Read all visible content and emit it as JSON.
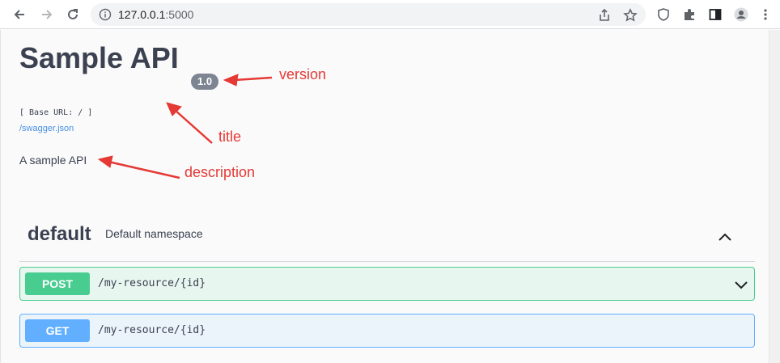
{
  "browser": {
    "url_host": "127.0.0.1",
    "url_port": ":5000"
  },
  "info": {
    "title": "Sample API",
    "version": "1.0",
    "base_url": "[ Base URL: / ]",
    "spec_link": "/swagger.json",
    "description": "A sample API"
  },
  "annotations": {
    "version": "version",
    "title": "title",
    "description": "description"
  },
  "namespace": {
    "name": "default",
    "description": "Default namespace"
  },
  "operations": [
    {
      "method": "POST",
      "path": "/my-resource/{id}"
    },
    {
      "method": "GET",
      "path": "/my-resource/{id}"
    }
  ],
  "colors": {
    "post": "#49cc90",
    "get": "#61affe",
    "annotation": "#e53935"
  }
}
